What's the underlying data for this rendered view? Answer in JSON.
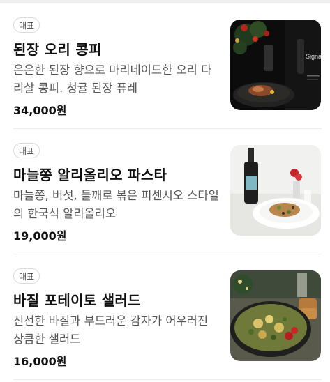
{
  "menu": {
    "items": [
      {
        "badge": "대표",
        "name": "된장 오리 콩피",
        "description": "은은한 된장 향으로 마리네이드한 오리 다리살 콩피. 청귤 된장 퓨레",
        "price": "34,000원",
        "photo_text": "Signa"
      },
      {
        "badge": "대표",
        "name": "마늘쫑 알리올리오 파스타",
        "description": "마늘쫑, 버섯, 들깨로 볶은 피센시오 스타일의 한국식 알리올리오",
        "price": "19,000원"
      },
      {
        "badge": "대표",
        "name": "바질 포테이토 샐러드",
        "description": "신선한 바질과 부드러운 감자가 어우러진 상큼한 샐러드",
        "price": "16,000원"
      }
    ]
  }
}
